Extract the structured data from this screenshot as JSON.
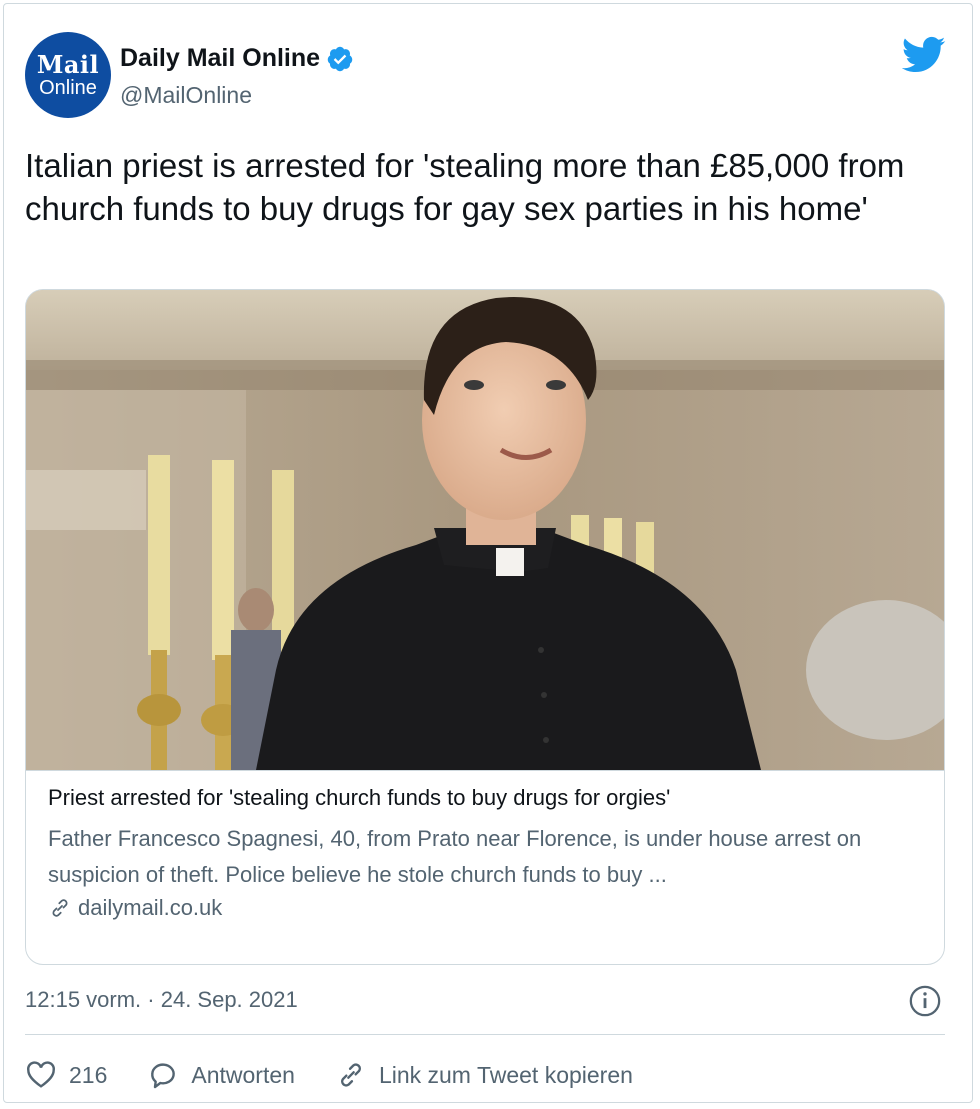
{
  "account": {
    "avatar_line1": "Mail",
    "avatar_line2": "Online",
    "name": "Daily Mail Online",
    "handle": "@MailOnline"
  },
  "tweet": {
    "text": "Italian priest is arrested for 'stealing more than £85,000 from church funds to buy drugs for gay sex parties in his home'",
    "timestamp": "12:15 vorm. · 24. Sep. 2021"
  },
  "card": {
    "title": "Priest arrested for 'stealing church funds to buy drugs for orgies'",
    "description": "Father Francesco Spagnesi, 40, from Prato near Florence, is under house arrest on suspicion of theft. Police believe he stole church funds to buy ...",
    "domain": "dailymail.co.uk"
  },
  "actions": {
    "likes": "216",
    "reply_label": "Antworten",
    "copy_link_label": "Link zum Tweet kopieren"
  },
  "icons": [
    "verified-icon",
    "twitter-bird-icon",
    "link-icon",
    "info-icon",
    "heart-icon",
    "reply-icon",
    "copy-link-icon"
  ],
  "colors": {
    "accent": "#1d9bf0",
    "avatar": "#0e4da1",
    "secondary_text": "#536471"
  }
}
